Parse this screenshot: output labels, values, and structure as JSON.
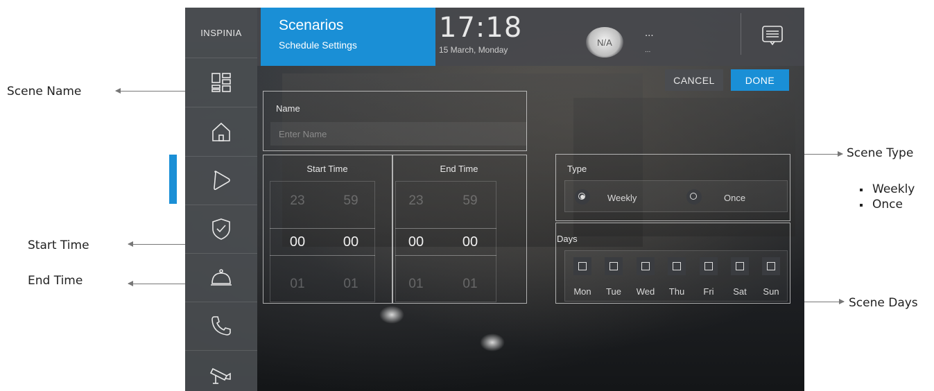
{
  "annotations": {
    "scene_name": "Scene Name",
    "start_time": "Start Time",
    "end_time": "End Time",
    "scene_type": "Scene Type",
    "scene_type_options": [
      "Weekly",
      "Once"
    ],
    "scene_days": "Scene Days"
  },
  "header": {
    "logo": "INSPINIA",
    "title": "Scenarios",
    "subtitle": "Schedule Settings",
    "time": "17:18",
    "date": "15 March, Monday",
    "weather": "N/A",
    "weather_text": "...",
    "weather_subtext": "..."
  },
  "actions": {
    "cancel": "CANCEL",
    "done": "DONE"
  },
  "sidebar": {
    "items": [
      {
        "icon": "dashboard-icon",
        "active": false
      },
      {
        "icon": "home-icon",
        "active": false
      },
      {
        "icon": "play-icon",
        "active": true
      },
      {
        "icon": "shield-check-icon",
        "active": false
      },
      {
        "icon": "service-bell-icon",
        "active": false
      },
      {
        "icon": "phone-icon",
        "active": false
      },
      {
        "icon": "camera-icon",
        "active": false
      }
    ]
  },
  "form": {
    "name_label": "Name",
    "name_placeholder": "Enter Name",
    "name_value": "",
    "start_time": {
      "header": "Start Time",
      "prev": [
        "23",
        "59"
      ],
      "selected": [
        "00",
        "00"
      ],
      "next": [
        "01",
        "01"
      ]
    },
    "end_time": {
      "header": "End Time",
      "prev": [
        "23",
        "59"
      ],
      "selected": [
        "00",
        "00"
      ],
      "next": [
        "01",
        "01"
      ]
    },
    "type_label": "Type",
    "type_options": [
      {
        "label": "Weekly",
        "selected": true
      },
      {
        "label": "Once",
        "selected": false
      }
    ],
    "days_label": "Days",
    "days": [
      "Mon",
      "Tue",
      "Wed",
      "Thu",
      "Fri",
      "Sat",
      "Sun"
    ]
  },
  "colors": {
    "accent": "#1a8fd6",
    "panel_border": "#dcdcdc",
    "text_light": "#e8e8e8"
  }
}
